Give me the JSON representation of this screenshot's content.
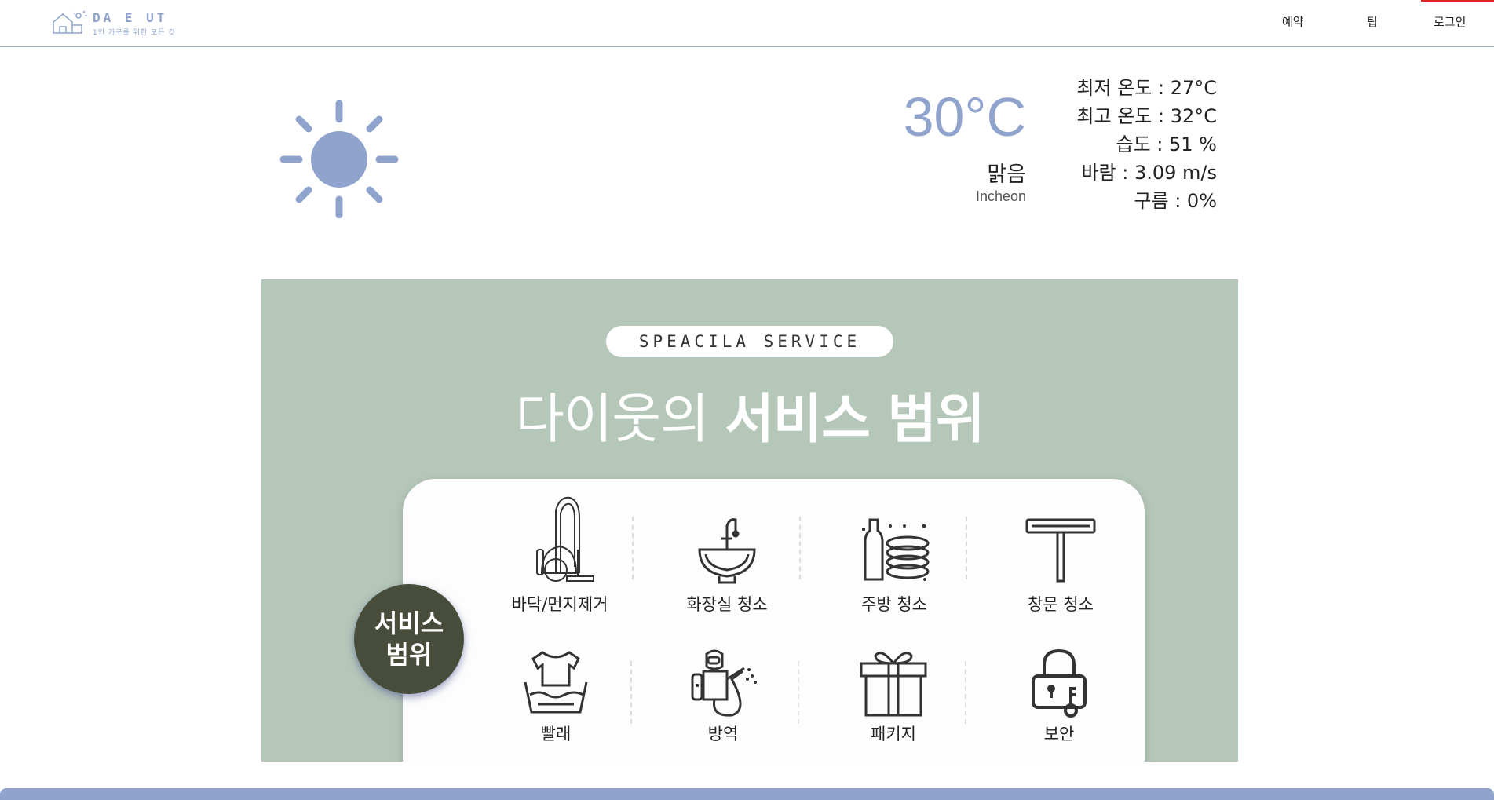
{
  "header": {
    "logo_title": "DA E UT",
    "logo_subtitle": "1인 가구를 위한 모든 것",
    "nav": {
      "reserve": "예약",
      "tip": "팁",
      "login": "로그인"
    }
  },
  "weather": {
    "icon": "sun-icon",
    "temperature": "30°C",
    "condition": "맑음",
    "city": "Incheon",
    "details": [
      "최저 온도 : 27°C",
      "최고 온도 : 32°C",
      "습도 : 51 %",
      "바람 : 3.09 m/s",
      "구름 : 0%"
    ]
  },
  "service": {
    "pill": "SPEACILA  SERVICE",
    "headline_light": "다이웃의",
    "headline_bold": "서비스 범위",
    "badge_line1": "서비스",
    "badge_line2": "범위",
    "items": [
      {
        "label": "바닥/먼지제거",
        "icon": "vacuum-icon"
      },
      {
        "label": "화장실 청소",
        "icon": "sink-icon"
      },
      {
        "label": "주방 청소",
        "icon": "dishes-icon"
      },
      {
        "label": "창문 청소",
        "icon": "squeegee-icon"
      },
      {
        "label": "빨래",
        "icon": "laundry-icon"
      },
      {
        "label": "방역",
        "icon": "disinfection-icon"
      },
      {
        "label": "패키지",
        "icon": "gift-icon"
      },
      {
        "label": "보안",
        "icon": "lock-icon"
      }
    ]
  },
  "colors": {
    "accent": "#8fa3cd",
    "section_bg": "#b5c7b9",
    "badge_bg": "#474d3a"
  }
}
